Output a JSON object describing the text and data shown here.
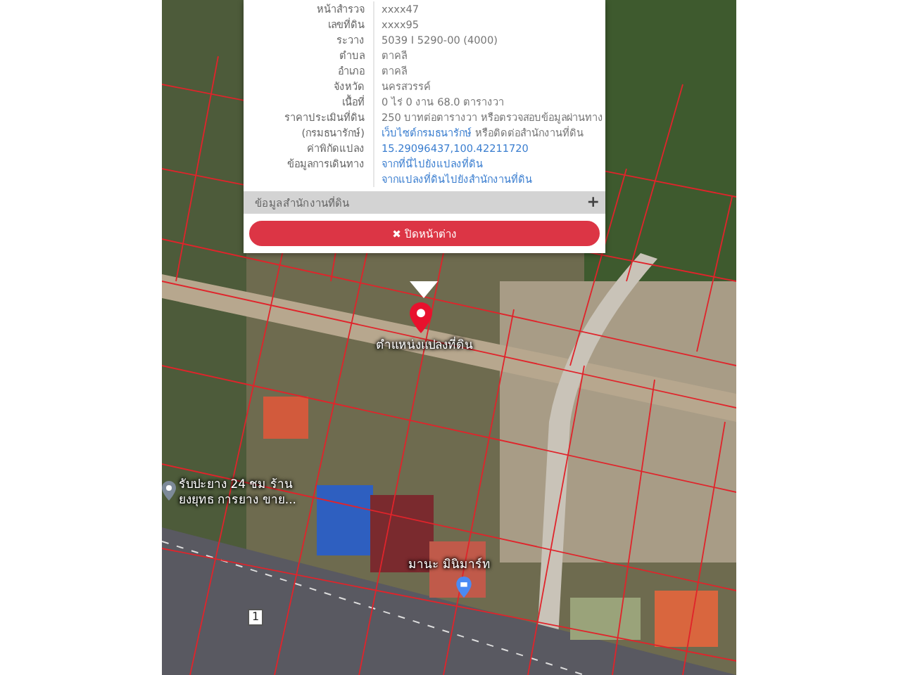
{
  "popup": {
    "rows": [
      {
        "label": "หน้าสำรวจ",
        "values": [
          [
            {
              "kind": "text",
              "text": "xxxx47"
            }
          ]
        ]
      },
      {
        "label": "เลขที่ดิน",
        "values": [
          [
            {
              "kind": "text",
              "text": "xxxx95"
            }
          ]
        ]
      },
      {
        "label": "ระวาง",
        "values": [
          [
            {
              "kind": "text",
              "text": "5039 I 5290-00 (4000)"
            }
          ]
        ]
      },
      {
        "label": "ตำบล",
        "values": [
          [
            {
              "kind": "text",
              "text": "ตาคลี"
            }
          ]
        ]
      },
      {
        "label": "อำเภอ",
        "values": [
          [
            {
              "kind": "text",
              "text": "ตาคลี"
            }
          ]
        ]
      },
      {
        "label": "จังหวัด",
        "values": [
          [
            {
              "kind": "text",
              "text": "นครสวรรค์"
            }
          ]
        ]
      },
      {
        "label": "เนื้อที่",
        "values": [
          [
            {
              "kind": "text",
              "text": "0 ไร่ 0 งาน 68.0 ตารางวา"
            }
          ]
        ]
      },
      {
        "label": "ราคาประเมินที่ดิน",
        "values": [
          [
            {
              "kind": "text",
              "text": "250 บาทต่อตารางวา หรือตรวจสอบข้อมูลผ่านทาง"
            }
          ]
        ]
      },
      {
        "label": "(กรมธนารักษ์)",
        "values": [
          [
            {
              "kind": "link",
              "text": "เว็บไซต์กรมธนารักษ์"
            },
            {
              "kind": "text",
              "text": " หรือติดต่อสำนักงานที่ดิน"
            }
          ]
        ]
      },
      {
        "label": "ค่าพิกัดแปลง",
        "values": [
          [
            {
              "kind": "link",
              "text": "15.29096437,100.42211720"
            }
          ]
        ]
      },
      {
        "label": "ข้อมูลการเดินทาง",
        "values": [
          [
            {
              "kind": "link",
              "text": "จากที่นี่ไปยังแปลงที่ดิน"
            }
          ],
          [
            {
              "kind": "link",
              "text": "จากแปลงที่ดินไปยังสำนักงานที่ดิน"
            }
          ]
        ]
      }
    ],
    "section": {
      "title": "ข้อมูลสำนักงานที่ดิน",
      "toggle": "+",
      "expanded": false
    },
    "close_button": {
      "icon": "✖",
      "label": "ปิดหน้าต่าง"
    }
  },
  "map": {
    "marker_label": "ตำแหน่งแปลงที่ดิน",
    "places": [
      {
        "kind": "place",
        "lines": [
          "รับปะยาง 24 ชม ร้าน",
          "ยงยุทธ การยาง ขาย..."
        ]
      },
      {
        "kind": "shop",
        "lines": [
          "มานะ มินิมาร์ท"
        ]
      }
    ],
    "road_shield": "1"
  }
}
